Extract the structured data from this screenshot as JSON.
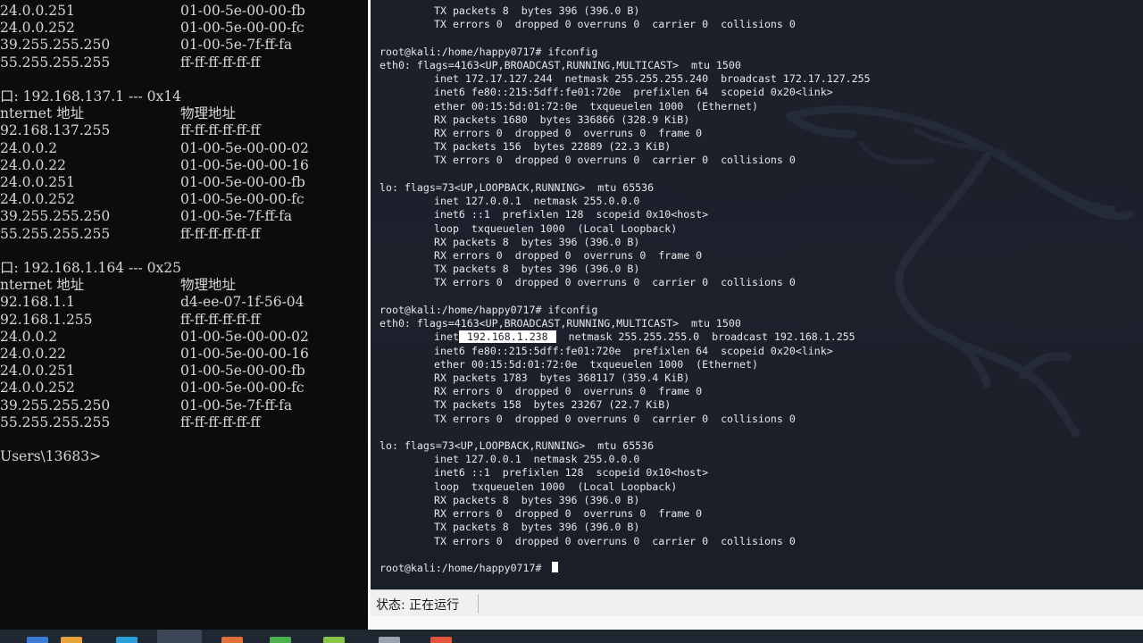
{
  "cmd": {
    "lines": [
      {
        "c1": "24.0.0.251",
        "c2": "01-00-5e-00-00-fb"
      },
      {
        "c1": "24.0.0.252",
        "c2": "01-00-5e-00-00-fc"
      },
      {
        "c1": "39.255.255.250",
        "c2": "01-00-5e-7f-ff-fa"
      },
      {
        "c1": "55.255.255.255",
        "c2": "ff-ff-ff-ff-ff-ff"
      },
      {
        "c1": "",
        "c2": ""
      },
      {
        "c1": "口: 192.168.137.1 --- 0x14",
        "c2": ""
      },
      {
        "c1": "nternet 地址",
        "c2": "物理地址"
      },
      {
        "c1": "92.168.137.255",
        "c2": "ff-ff-ff-ff-ff-ff"
      },
      {
        "c1": "24.0.0.2",
        "c2": "01-00-5e-00-00-02"
      },
      {
        "c1": "24.0.0.22",
        "c2": "01-00-5e-00-00-16"
      },
      {
        "c1": "24.0.0.251",
        "c2": "01-00-5e-00-00-fb"
      },
      {
        "c1": "24.0.0.252",
        "c2": "01-00-5e-00-00-fc"
      },
      {
        "c1": "39.255.255.250",
        "c2": "01-00-5e-7f-ff-fa"
      },
      {
        "c1": "55.255.255.255",
        "c2": "ff-ff-ff-ff-ff-ff"
      },
      {
        "c1": "",
        "c2": ""
      },
      {
        "c1": "口: 192.168.1.164 --- 0x25",
        "c2": ""
      },
      {
        "c1": "nternet 地址",
        "c2": "物理地址"
      },
      {
        "c1": "92.168.1.1",
        "c2": "d4-ee-07-1f-56-04"
      },
      {
        "c1": "92.168.1.255",
        "c2": "ff-ff-ff-ff-ff-ff"
      },
      {
        "c1": "24.0.0.2",
        "c2": "01-00-5e-00-00-02"
      },
      {
        "c1": "24.0.0.22",
        "c2": "01-00-5e-00-00-16"
      },
      {
        "c1": "24.0.0.251",
        "c2": "01-00-5e-00-00-fb"
      },
      {
        "c1": "24.0.0.252",
        "c2": "01-00-5e-00-00-fc"
      },
      {
        "c1": "39.255.255.250",
        "c2": "01-00-5e-7f-ff-fa"
      },
      {
        "c1": "55.255.255.255",
        "c2": "ff-ff-ff-ff-ff-ff"
      },
      {
        "c1": "",
        "c2": ""
      },
      {
        "c1": "Users\\13683>",
        "c2": ""
      }
    ]
  },
  "terminal": {
    "lines": [
      {
        "text": "TX packets 8  bytes 396 (396.0 B)",
        "indent": true
      },
      {
        "text": "TX errors 0  dropped 0 overruns 0  carrier 0  collisions 0",
        "indent": true
      },
      {
        "text": "",
        "indent": false
      },
      {
        "text": "root@kali:/home/happy0717# ifconfig",
        "indent": false
      },
      {
        "text": "eth0: flags=4163<UP,BROADCAST,RUNNING,MULTICAST>  mtu 1500",
        "indent": false
      },
      {
        "text": "inet 172.17.127.244  netmask 255.255.255.240  broadcast 172.17.127.255",
        "indent": true
      },
      {
        "text": "inet6 fe80::215:5dff:fe01:720e  prefixlen 64  scopeid 0x20<link>",
        "indent": true
      },
      {
        "text": "ether 00:15:5d:01:72:0e  txqueuelen 1000  (Ethernet)",
        "indent": true
      },
      {
        "text": "RX packets 1680  bytes 336866 (328.9 KiB)",
        "indent": true
      },
      {
        "text": "RX errors 0  dropped 0  overruns 0  frame 0",
        "indent": true
      },
      {
        "text": "TX packets 156  bytes 22889 (22.3 KiB)",
        "indent": true
      },
      {
        "text": "TX errors 0  dropped 0 overruns 0  carrier 0  collisions 0",
        "indent": true
      },
      {
        "text": "",
        "indent": false
      },
      {
        "text": "lo: flags=73<UP,LOOPBACK,RUNNING>  mtu 65536",
        "indent": false
      },
      {
        "text": "inet 127.0.0.1  netmask 255.0.0.0",
        "indent": true
      },
      {
        "text": "inet6 ::1  prefixlen 128  scopeid 0x10<host>",
        "indent": true
      },
      {
        "text": "loop  txqueuelen 1000  (Local Loopback)",
        "indent": true
      },
      {
        "text": "RX packets 8  bytes 396 (396.0 B)",
        "indent": true
      },
      {
        "text": "RX errors 0  dropped 0  overruns 0  frame 0",
        "indent": true
      },
      {
        "text": "TX packets 8  bytes 396 (396.0 B)",
        "indent": true
      },
      {
        "text": "TX errors 0  dropped 0 overruns 0  carrier 0  collisions 0",
        "indent": true
      },
      {
        "text": "",
        "indent": false
      },
      {
        "text": "root@kali:/home/happy0717# ifconfig",
        "indent": false
      },
      {
        "text": "eth0: flags=4163<UP,BROADCAST,RUNNING,MULTICAST>  mtu 1500",
        "indent": false
      },
      {
        "text": "",
        "indent": true,
        "highlight": {
          "pre": "inet",
          "hl": " 192.168.1.238 ",
          "post": "  netmask 255.255.255.0  broadcast 192.168.1.255"
        }
      },
      {
        "text": "inet6 fe80::215:5dff:fe01:720e  prefixlen 64  scopeid 0x20<link>",
        "indent": true
      },
      {
        "text": "ether 00:15:5d:01:72:0e  txqueuelen 1000  (Ethernet)",
        "indent": true
      },
      {
        "text": "RX packets 1783  bytes 368117 (359.4 KiB)",
        "indent": true
      },
      {
        "text": "RX errors 0  dropped 0  overruns 0  frame 0",
        "indent": true
      },
      {
        "text": "TX packets 158  bytes 23267 (22.7 KiB)",
        "indent": true
      },
      {
        "text": "TX errors 0  dropped 0 overruns 0  carrier 0  collisions 0",
        "indent": true
      },
      {
        "text": "",
        "indent": false
      },
      {
        "text": "lo: flags=73<UP,LOOPBACK,RUNNING>  mtu 65536",
        "indent": false
      },
      {
        "text": "inet 127.0.0.1  netmask 255.0.0.0",
        "indent": true
      },
      {
        "text": "inet6 ::1  prefixlen 128  scopeid 0x10<host>",
        "indent": true
      },
      {
        "text": "loop  txqueuelen 1000  (Local Loopback)",
        "indent": true
      },
      {
        "text": "RX packets 8  bytes 396 (396.0 B)",
        "indent": true
      },
      {
        "text": "RX errors 0  dropped 0  overruns 0  frame 0",
        "indent": true
      },
      {
        "text": "TX packets 8  bytes 396 (396.0 B)",
        "indent": true
      },
      {
        "text": "TX errors 0  dropped 0 overruns 0  carrier 0  collisions 0",
        "indent": true
      },
      {
        "text": "",
        "indent": false
      },
      {
        "text": "root@kali:/home/happy0717# ",
        "indent": false,
        "prompt": true
      }
    ]
  },
  "statusbar": {
    "text": "状态: 正在运行"
  },
  "colors": {
    "terminal_bg": "#1c212c",
    "terminal_fg": "#e6e6e6",
    "cmd_bg": "#0c0c0c",
    "cmd_fg": "#d6d6d6",
    "statusbar_bg": "#f0f0f0",
    "taskbar_bg": "#1f2733"
  },
  "taskbar_icons": [
    "start-icon",
    "browser-icon",
    "app-icon",
    "app-icon",
    "app-icon",
    "app-icon",
    "app-icon",
    "app-icon"
  ]
}
